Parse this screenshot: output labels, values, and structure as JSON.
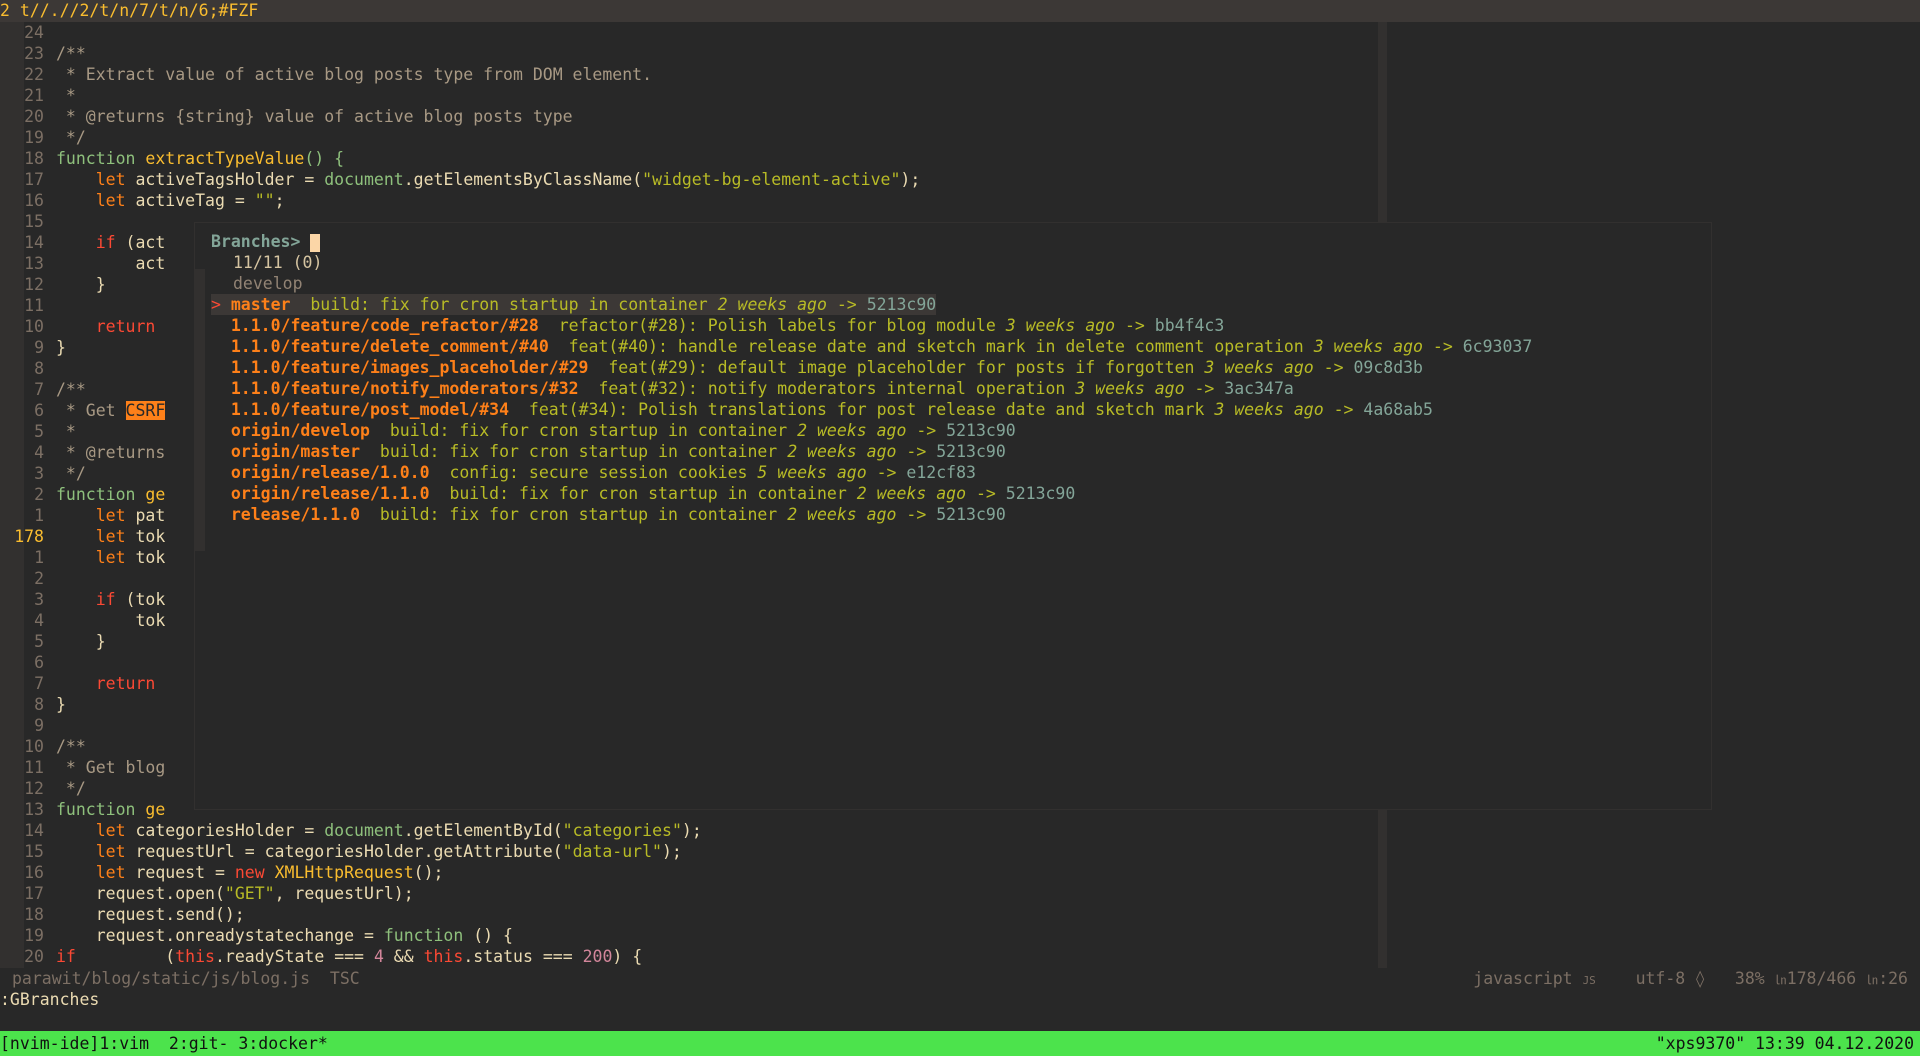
{
  "tabline": {
    "number": "2",
    "title": "t//.//2/t/n/7/t/n/6;#FZF"
  },
  "code_lines": [
    {
      "n": "24"
    },
    {
      "n": "23",
      "t": "/**"
    },
    {
      "n": "22",
      "t": " * Extract value of active blog posts type from DOM element."
    },
    {
      "n": "21",
      "t": " *"
    },
    {
      "n": "20",
      "t": " * @returns {string} value of active blog posts type"
    },
    {
      "n": "19",
      "t": " */"
    },
    {
      "n": "18",
      "a": "function ",
      "b": "extractTypeValue",
      "c": "() {"
    },
    {
      "n": "17",
      "a": "    let ",
      "b": "activeTagsHolder = ",
      "c": "document",
      ".d": "",
      "d": ".getElementsByClassName(",
      "e": "\"widget-bg-element-active\"",
      "f": ");"
    },
    {
      "n": "16",
      "a": "    let ",
      "b": "activeTag = ",
      "e": "\"\"",
      "f": ";"
    },
    {
      "n": "15"
    },
    {
      "n": "14",
      "a": "    if ",
      "b": "(act"
    },
    {
      "n": "13",
      "b": "        act"
    },
    {
      "n": "12",
      "b": "    }"
    },
    {
      "n": "11"
    },
    {
      "n": "10",
      "a": "    return"
    },
    {
      "n": "9",
      "b": "}"
    },
    {
      "n": "8"
    },
    {
      "n": "7",
      "t": "/**"
    },
    {
      "n": "6",
      "t": " * Get ",
      "h": "CSRF"
    },
    {
      "n": "5",
      "t": " *"
    },
    {
      "n": "4",
      "t": " * @returns"
    },
    {
      "n": "3",
      "t": " */"
    },
    {
      "n": "2",
      "a": "function ",
      "b": "ge"
    },
    {
      "n": "1",
      "a": "    let ",
      "b": "pat"
    },
    {
      "n": "178",
      "a": "    let ",
      "b": "tok",
      "cur": true
    },
    {
      "n": "1",
      "a": "    let ",
      "b": "tok"
    },
    {
      "n": "2"
    },
    {
      "n": "3",
      "a": "    if ",
      "b": "(tok"
    },
    {
      "n": "4",
      "b": "        tok"
    },
    {
      "n": "5",
      "b": "    }"
    },
    {
      "n": "6"
    },
    {
      "n": "7",
      "a": "    return"
    },
    {
      "n": "8",
      "b": "}"
    },
    {
      "n": "9"
    },
    {
      "n": "10",
      "t": "/**"
    },
    {
      "n": "11",
      "t": " * Get blog"
    },
    {
      "n": "12",
      "t": " */"
    },
    {
      "n": "13",
      "a": "function ",
      "b": "ge"
    },
    {
      "n": "14",
      "a": "    let ",
      "b": "categoriesHolder = ",
      "c": "document",
      "d": ".getElementById(",
      "e": "\"categories\"",
      "f": ");"
    },
    {
      "n": "15",
      "a": "    let ",
      "b": "requestUrl = categoriesHolder.getAttribute(",
      "e": "\"data-url\"",
      "f": ");"
    },
    {
      "n": "16",
      "a": "    let ",
      "b": "request = ",
      "g": "new ",
      "c2": "XMLHttpRequest",
      "f": "();"
    },
    {
      "n": "17",
      "b": "    request.open(",
      "e": "\"GET\"",
      "f": ", requestUrl);"
    },
    {
      "n": "18",
      "b": "    request.send();"
    },
    {
      "n": "19",
      "b": "    request.onreadystatechange = ",
      "k": "function",
      "f": " () {"
    },
    {
      "n": "20",
      "b": "        ",
      "a": "if ",
      "x": "(",
      "y": "this",
      ".z": "",
      "z": ".readyState === ",
      "num": "4",
      "w": " && ",
      "y2": "this",
      "z2": ".status === ",
      "num2": "200",
      "f": ") {"
    }
  ],
  "fzf": {
    "prompt": "Branches>",
    "info": "11/11 (0)",
    "header": "develop",
    "items": [
      {
        "branch": "master",
        "msg": "build: fix for cron startup in container",
        "ago": "2 weeks ago",
        "hash": "5213c90",
        "selected": true
      },
      {
        "branch": "1.1.0/feature/code_refactor/#28",
        "msg": "refactor(#28): Polish labels for blog module",
        "ago": "3 weeks ago",
        "hash": "bb4f4c3"
      },
      {
        "branch": "1.1.0/feature/delete_comment/#40",
        "msg": "feat(#40): handle release date and sketch mark in delete comment operation",
        "ago": "3 weeks ago",
        "hash": "6c93037"
      },
      {
        "branch": "1.1.0/feature/images_placeholder/#29",
        "msg": "feat(#29): default image placeholder for posts if forgotten",
        "ago": "3 weeks ago",
        "hash": "09c8d3b"
      },
      {
        "branch": "1.1.0/feature/notify_moderators/#32",
        "msg": "feat(#32): notify moderators internal operation",
        "ago": "3 weeks ago",
        "hash": "3ac347a"
      },
      {
        "branch": "1.1.0/feature/post_model/#34",
        "msg": "feat(#34): Polish translations for post release date and sketch mark",
        "ago": "3 weeks ago",
        "hash": "4a68ab5"
      },
      {
        "branch": "origin/develop",
        "msg": "build: fix for cron startup in container",
        "ago": "2 weeks ago",
        "hash": "5213c90"
      },
      {
        "branch": "origin/master",
        "msg": "build: fix for cron startup in container",
        "ago": "2 weeks ago",
        "hash": "5213c90"
      },
      {
        "branch": "origin/release/1.0.0",
        "msg": "config: secure session cookies",
        "ago": "5 weeks ago",
        "hash": "e12cf83"
      },
      {
        "branch": "origin/release/1.1.0",
        "msg": "build: fix for cron startup in container",
        "ago": "2 weeks ago",
        "hash": "5213c90"
      },
      {
        "branch": "release/1.1.0",
        "msg": "build: fix for cron startup in container",
        "ago": "2 weeks ago",
        "hash": "5213c90"
      }
    ]
  },
  "statusline": {
    "file": "parawit/blog/static/js/blog.js",
    "lint": "TSC",
    "filetype": "javascript",
    "filetype_icon": "JS",
    "encoding": "utf-8",
    "percent": "38%",
    "position": "178/466",
    "column": ":26"
  },
  "cmdline": ":GBranches",
  "tmux": {
    "session": "[nvim-ide]",
    "windows": "1:vim  2:git- 3:docker*",
    "right": "\"xps9370\" 13:39 04.12.2020"
  }
}
